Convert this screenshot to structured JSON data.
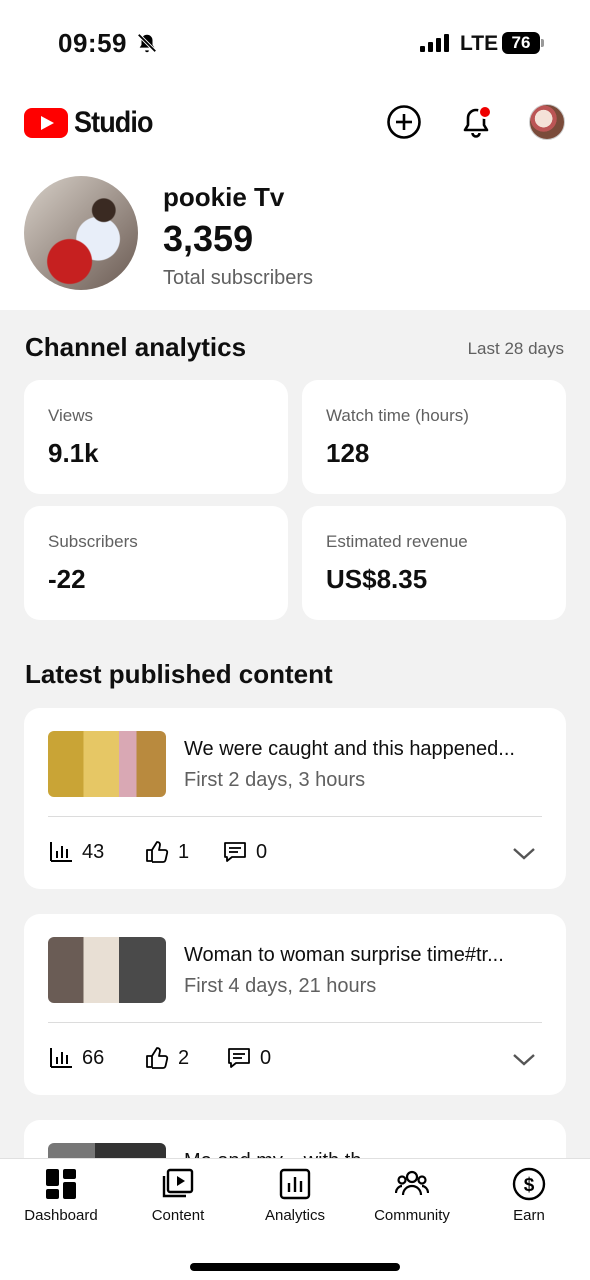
{
  "status_bar": {
    "time": "09:59",
    "network": "LTE",
    "battery": "76"
  },
  "header": {
    "logo_text": "Studio",
    "icons": [
      "create-icon",
      "notifications-icon"
    ]
  },
  "channel": {
    "name": "pookie Tv",
    "subscriber_count": "3,359",
    "subscriber_label": "Total subscribers"
  },
  "analytics": {
    "title": "Channel analytics",
    "period": "Last 28 days",
    "cards": [
      {
        "label": "Views",
        "value": "9.1k"
      },
      {
        "label": "Watch time (hours)",
        "value": "128"
      },
      {
        "label": "Subscribers",
        "value": "-22"
      },
      {
        "label": "Estimated revenue",
        "value": "US$8.35"
      }
    ]
  },
  "latest": {
    "title": "Latest published content",
    "items": [
      {
        "title": "We were caught and this happened...",
        "subtitle": "First 2 days, 3 hours",
        "views": "43",
        "likes": "1",
        "comments": "0"
      },
      {
        "title": "Woman to woman surprise time#tr...",
        "subtitle": "First 4 days, 21 hours",
        "views": "66",
        "likes": "2",
        "comments": "0"
      },
      {
        "title": "Me and my... with th...",
        "subtitle": ""
      }
    ]
  },
  "nav": {
    "items": [
      {
        "label": "Dashboard",
        "icon": "dashboard-icon"
      },
      {
        "label": "Content",
        "icon": "content-icon"
      },
      {
        "label": "Analytics",
        "icon": "analytics-icon"
      },
      {
        "label": "Community",
        "icon": "community-icon"
      },
      {
        "label": "Earn",
        "icon": "earn-icon"
      }
    ]
  }
}
